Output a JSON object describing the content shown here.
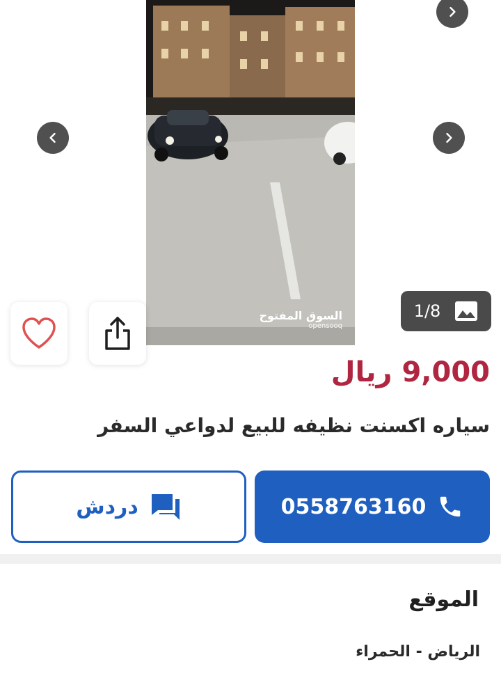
{
  "gallery": {
    "watermark_ar": "السوق المفتوح",
    "watermark_en": "opensooq",
    "counter": "1/8",
    "icons": {
      "prev": "chevron-left-icon",
      "next": "chevron-right-icon",
      "image": "image-icon"
    }
  },
  "actions": {
    "favorite_icon": "heart-icon",
    "share_icon": "share-icon"
  },
  "listing": {
    "price": "9,000 ريال",
    "title": "سياره اكسنت نظيفه للبيع لدواعي السفر"
  },
  "contact": {
    "phone": "0558763160",
    "chat_label": "دردش"
  },
  "location": {
    "heading": "الموقع",
    "value": "الرياض - الحمراء"
  },
  "colors": {
    "accent": "#1f5fbf",
    "price": "#b0253f",
    "heart": "#e05252"
  }
}
